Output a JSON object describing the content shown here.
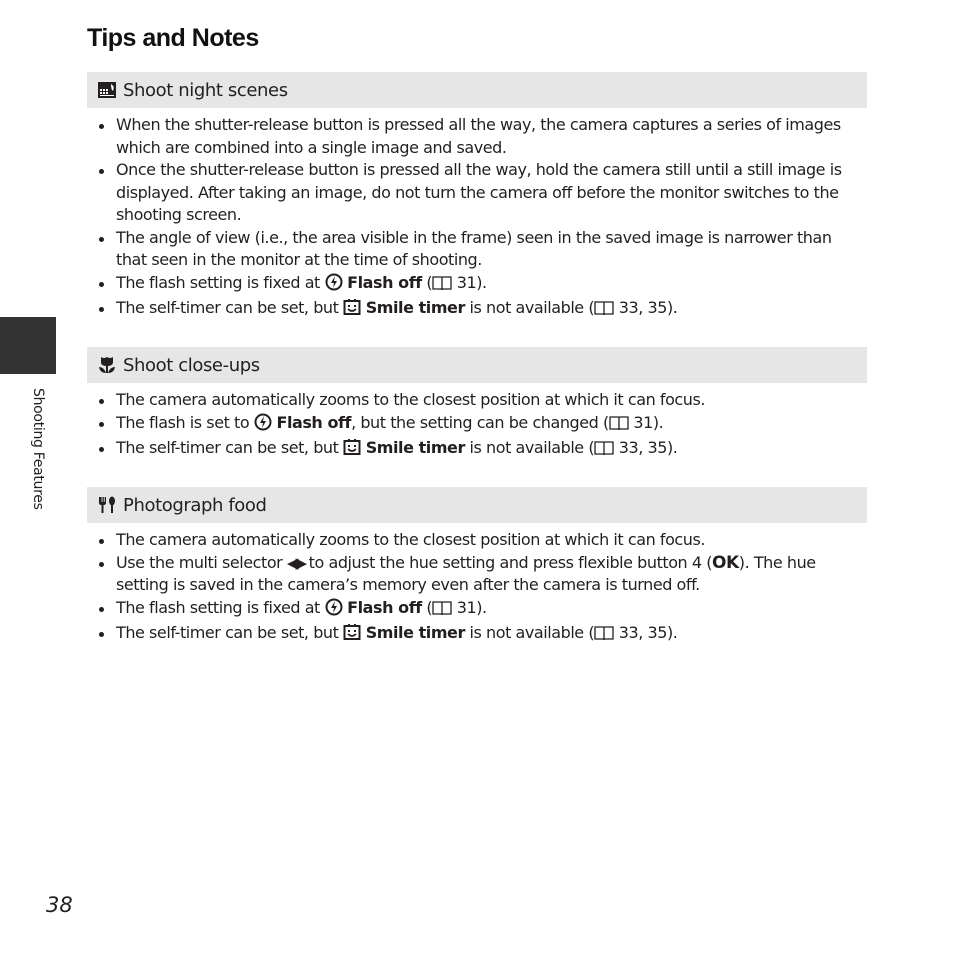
{
  "page": {
    "title": "Tips and Notes",
    "side_tab_label": "Shooting Features",
    "page_number": "38"
  },
  "sections": [
    {
      "icon": "night-landscape-icon",
      "heading": "Shoot night scenes",
      "bullets": [
        {
          "text": "When the shutter-release button is pressed all the way, the camera captures a series of images which are combined into a single image and saved."
        },
        {
          "text": "Once the shutter-release button is pressed all the way, hold the camera still until a still image is displayed. After taking an image, do not turn the camera off before the monitor switches to the shooting screen."
        },
        {
          "text": "The angle of view (i.e., the area visible in the frame) seen in the saved image is narrower than that seen in the monitor at the time of shooting."
        },
        {
          "pre": "The flash setting is fixed at ",
          "icon": "flash-off-icon",
          "bold": "Flash off",
          "mid": " (",
          "ref_icon": "book-reference-icon",
          "post": " 31)."
        },
        {
          "pre": "The self-timer can be set, but ",
          "icon": "smile-timer-icon",
          "bold": "Smile timer",
          "mid": " is not available (",
          "ref_icon": "book-reference-icon",
          "post": " 33, 35)."
        }
      ]
    },
    {
      "icon": "macro-flower-icon",
      "heading": "Shoot close-ups",
      "bullets": [
        {
          "text": "The camera automatically zooms to the closest position at which it can focus."
        },
        {
          "pre": "The flash is set to ",
          "icon": "flash-off-icon",
          "bold": "Flash off",
          "mid": ", but the setting can be changed (",
          "ref_icon": "book-reference-icon",
          "post": " 31)."
        },
        {
          "pre": "The self-timer can be set, but ",
          "icon": "smile-timer-icon",
          "bold": "Smile timer",
          "mid": " is not available (",
          "ref_icon": "book-reference-icon",
          "post": " 33, 35)."
        }
      ]
    },
    {
      "icon": "food-utensils-icon",
      "heading": "Photograph food",
      "bullets": [
        {
          "text": "The camera automatically zooms to the closest position at which it can focus."
        },
        {
          "pre": "Use the multi selector ",
          "arrows": "◀▶",
          "mid": " to adjust the hue setting and press flexible button 4 (",
          "ok": "OK",
          "post": "). The hue setting is saved in the camera’s memory even after the camera is turned off."
        },
        {
          "pre": "The flash setting is fixed at ",
          "icon": "flash-off-icon",
          "bold": "Flash off",
          "mid": " (",
          "ref_icon": "book-reference-icon",
          "post": " 31)."
        },
        {
          "pre": "The self-timer can be set, but ",
          "icon": "smile-timer-icon",
          "bold": "Smile timer",
          "mid": " is not available (",
          "ref_icon": "book-reference-icon",
          "post": " 33, 35)."
        }
      ]
    }
  ]
}
